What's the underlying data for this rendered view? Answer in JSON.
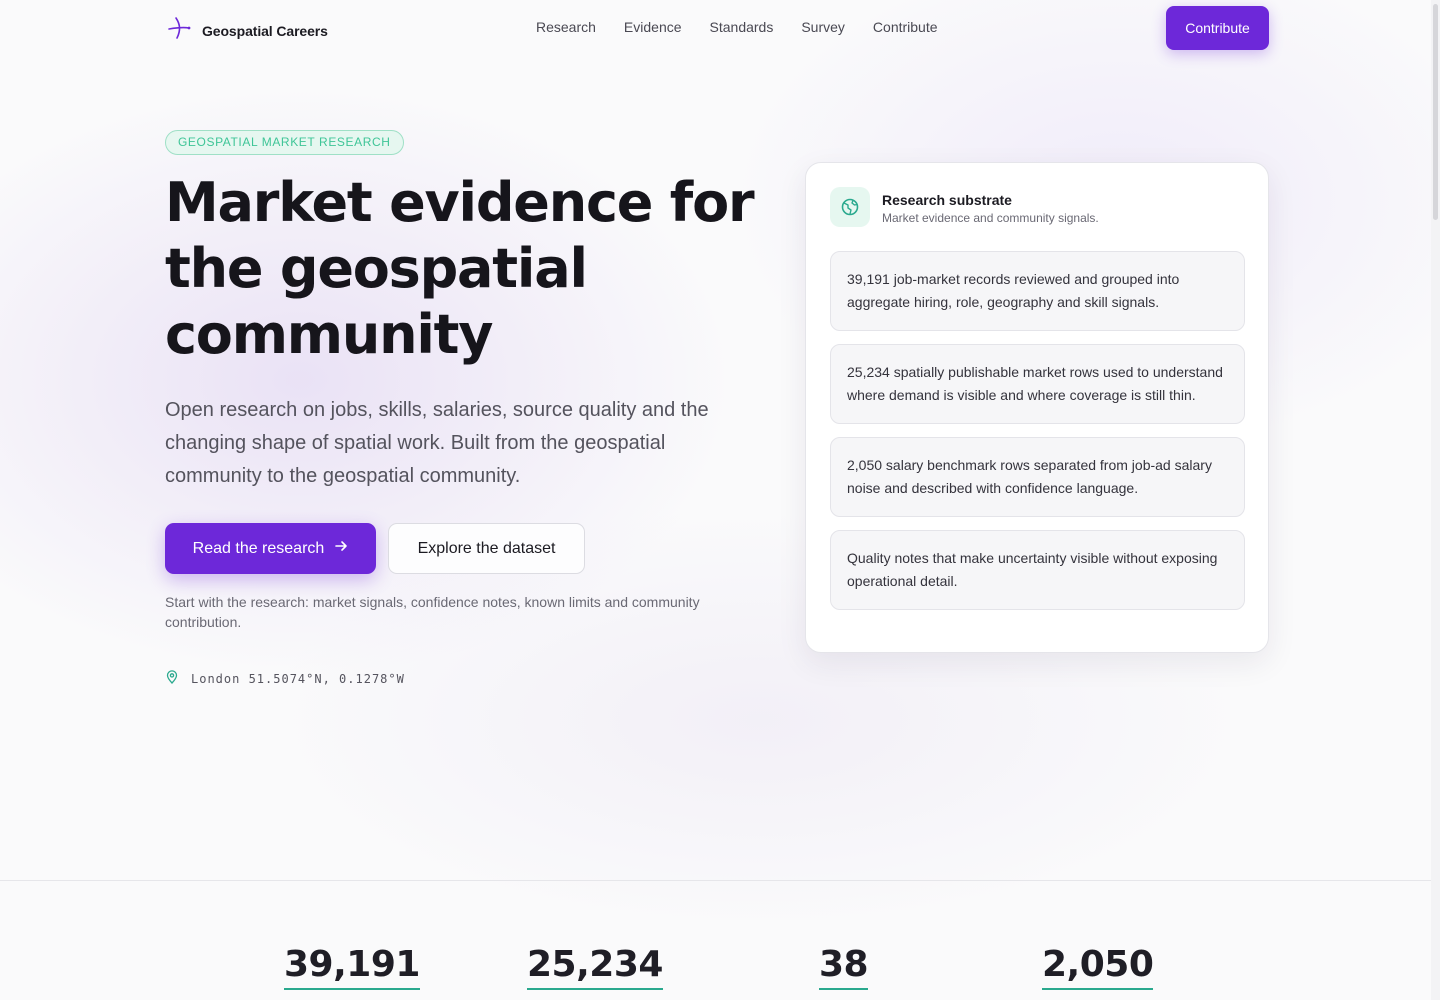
{
  "nav": {
    "brand": "Geospatial Careers",
    "links": [
      "Research",
      "Evidence",
      "Standards",
      "Survey",
      "Contribute"
    ],
    "cta": "Contribute"
  },
  "hero": {
    "eyebrow": "GEOSPATIAL MARKET RESEARCH",
    "headline": "Market evidence for the geospatial community",
    "lede": "Open research on jobs, skills, salaries, source quality and the changing shape of spatial work. Built from the geospatial community to the geospatial community.",
    "primary_cta": "Read the research",
    "secondary_cta": "Explore the dataset",
    "note": "Start with the research: market signals, confidence notes, known limits and community contribution.",
    "location": "London 51.5074°N, 0.1278°W"
  },
  "card": {
    "title": "Research substrate",
    "subtitle": "Market evidence and community signals.",
    "items": [
      "39,191 job-market records reviewed and grouped into aggregate hiring, role, geography and skill signals.",
      "25,234 spatially publishable market rows used to understand where demand is visible and where coverage is still thin.",
      "2,050 salary benchmark rows separated from job-ad salary noise and described with confidence language.",
      "Quality notes that make uncertainty visible without exposing operational detail."
    ]
  },
  "stats": [
    "39,191",
    "25,234",
    "38",
    "2,050"
  ],
  "colors": {
    "accent": "#6d28d9",
    "eyebrow_text": "#3fc597",
    "stat_underline": "#2aa98e"
  }
}
